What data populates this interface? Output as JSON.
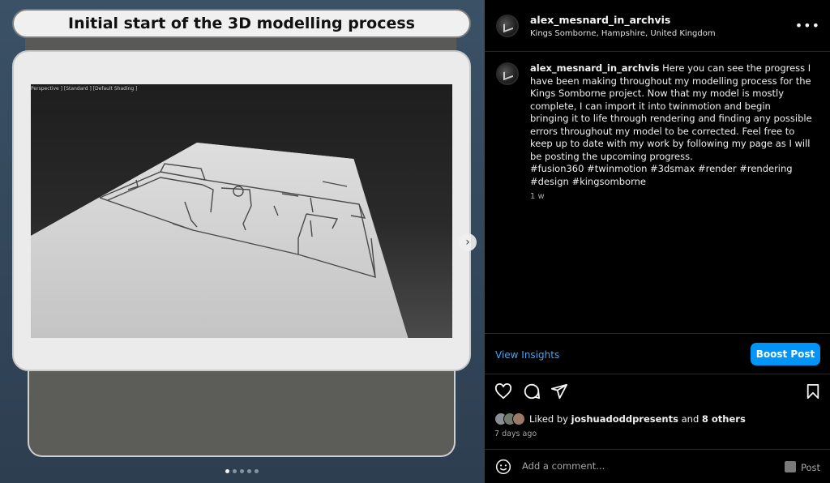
{
  "media": {
    "slide_title": "Initial start of the 3D modelling process",
    "viewport_label": "Perspective ] [Standard ] [Default Shading ]",
    "next_icon": "chevron-right-icon",
    "carousel": {
      "count": 5,
      "active": 0
    }
  },
  "post": {
    "username": "alex_mesnard_in_archvis",
    "location": "Kings Somborne, Hampshire, United Kingdom",
    "more_label": "•••",
    "caption_text": "Here you can see the progress I have been making throughout my modelling process for the Kings Somborne project. Now that my model is mostly complete, I can import it into twinmotion and begin bringing it to life through rendering and finding any possible errors throughout my model to be corrected. Feel free to keep up to date with my work by following my page as I will be posting the upcoming progress.",
    "hashtags": "#fusion360 #twinmotion #3dsmax #render #rendering #design #kingsomborne",
    "time_ago": "1 w"
  },
  "insights": {
    "view_label": "View Insights",
    "boost_label": "Boost Post"
  },
  "likes": {
    "prefix": "Liked by",
    "first_user": "joshuadoddpresents",
    "connector": "and",
    "others": "8 others"
  },
  "post_time": "7 days ago",
  "comment": {
    "placeholder": "Add a comment...",
    "post_label": "Post"
  },
  "colors": {
    "accent": "#0095f6",
    "link": "#3ea6ff",
    "muted": "#a8a8a8"
  },
  "icons": [
    "heart-icon",
    "comment-icon",
    "share-icon",
    "bookmark-icon",
    "emoji-icon"
  ]
}
